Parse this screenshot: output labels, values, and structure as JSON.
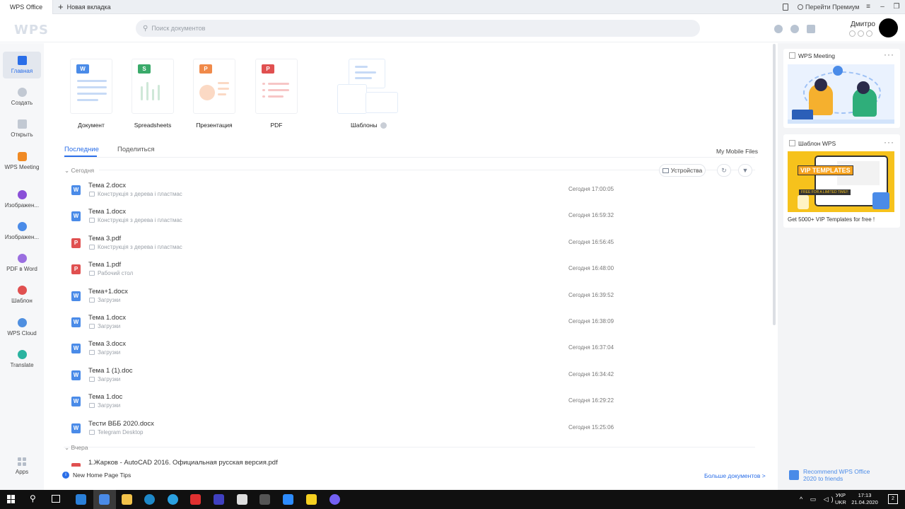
{
  "tabs": {
    "app": "WPS Office",
    "new_tab": "Новая вкладка"
  },
  "titlebar": {
    "premium": "Перейти Премиум"
  },
  "header": {
    "logo": "WPS",
    "search_placeholder": "Поиск документов",
    "username": "Дмитро"
  },
  "sidebar": {
    "items": [
      {
        "label": "Главная",
        "icon": "home-icon",
        "color": "#2a6ee8"
      },
      {
        "label": "Создать",
        "icon": "plus-icon",
        "color": "#b7bfca"
      },
      {
        "label": "Открыть",
        "icon": "folder-icon",
        "color": "#b7bfca"
      },
      {
        "label": "WPS Meeting",
        "icon": "meeting-icon",
        "color": "#f08a24"
      },
      {
        "label": "Изображен...",
        "icon": "image-tool-icon",
        "color": "#8a4fd8"
      },
      {
        "label": "Изображен...",
        "icon": "image-convert-icon",
        "color": "#4a8be8"
      },
      {
        "label": "PDF в Word",
        "icon": "pdf-to-word-icon",
        "color": "#9a6ee0"
      },
      {
        "label": "Шаблон",
        "icon": "template-icon",
        "color": "#e05050"
      },
      {
        "label": "WPS Cloud",
        "icon": "cloud-icon",
        "color": "#4f8fe0"
      },
      {
        "label": "Translate",
        "icon": "translate-icon",
        "color": "#2ab3a0"
      }
    ],
    "apps_label": "Apps"
  },
  "new_docs": [
    {
      "label": "Документ",
      "badge": "W",
      "color": "#4a8be8"
    },
    {
      "label": "Spreadsheets",
      "badge": "S",
      "color": "#3aaa6a"
    },
    {
      "label": "Презентация",
      "badge": "P",
      "color": "#f08a4a"
    },
    {
      "label": "PDF",
      "badge": "P",
      "color": "#e05050"
    }
  ],
  "templates_label": "Шаблоны",
  "file_tabs": {
    "recent": "Последние",
    "share": "Поделиться",
    "mobile": "My Mobile Files"
  },
  "devices_label": "Устройства",
  "sections": {
    "today": "Сегодня",
    "yesterday": "Вчера"
  },
  "files": [
    {
      "name": "Тема 2.docx",
      "location": "Конструкція з дерева і пластмас",
      "time": "Сегодня 17:00:05",
      "type": "W",
      "color": "#4a8be8"
    },
    {
      "name": "Тема 1.docx",
      "location": "Конструкція з дерева і пластмас",
      "time": "Сегодня 16:59:32",
      "type": "W",
      "color": "#4a8be8"
    },
    {
      "name": "Тема 3.pdf",
      "location": "Конструкція з дерева і пластмас",
      "time": "Сегодня 16:56:45",
      "type": "P",
      "color": "#e05050"
    },
    {
      "name": "Тема 1.pdf",
      "location": "Рабочий стол",
      "time": "Сегодня 16:48:00",
      "type": "P",
      "color": "#e05050"
    },
    {
      "name": "Тема+1.docx",
      "location": "Загрузки",
      "time": "Сегодня 16:39:52",
      "type": "W",
      "color": "#4a8be8"
    },
    {
      "name": "Тема 1.docx",
      "location": "Загрузки",
      "time": "Сегодня 16:38:09",
      "type": "W",
      "color": "#4a8be8"
    },
    {
      "name": "Тема 3.docx",
      "location": "Загрузки",
      "time": "Сегодня 16:37:04",
      "type": "W",
      "color": "#4a8be8"
    },
    {
      "name": "Тема 1 (1).doc",
      "location": "Загрузки",
      "time": "Сегодня 16:34:42",
      "type": "W",
      "color": "#4a8be8"
    },
    {
      "name": "Тема 1.doc",
      "location": "Загрузки",
      "time": "Сегодня 16:29:22",
      "type": "W",
      "color": "#4a8be8"
    },
    {
      "name": "Тести ВББ 2020.docx",
      "location": "Telegram Desktop",
      "time": "Сегодня 15:25:06",
      "type": "W",
      "color": "#4a8be8"
    }
  ],
  "yesterday_file": "1.Жарков - AutoCAD 2016. Официальная русская версия.pdf",
  "footer": {
    "tips": "New Home Page Tips",
    "more": "Больше документов >"
  },
  "right_panel": {
    "meeting_title": "WPS Meeting",
    "template_title": "Шаблон WPS",
    "vip_banner": "VIP TEMPLATES",
    "vip_sub": "FREE FOR A LIMITED TIME!!",
    "vip_caption": "Get 5000+ VIP Templates for free !",
    "recommend": "Recommend WPS Office 2020 to friends"
  },
  "taskbar": {
    "lang1": "УКР",
    "lang2": "UKR",
    "time": "17:13",
    "date": "21.04.2020",
    "notif": "2"
  }
}
